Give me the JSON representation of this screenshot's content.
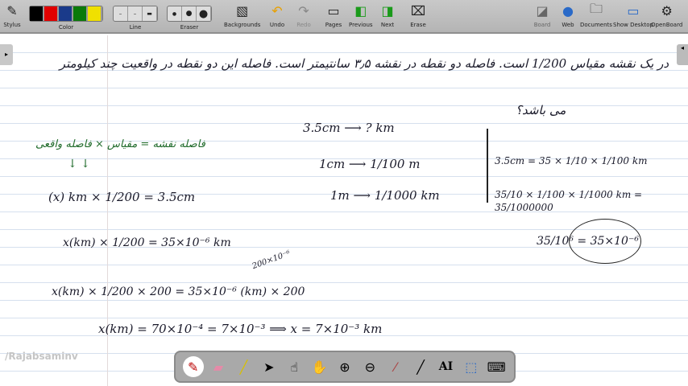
{
  "toolbar": {
    "stylus": "Stylus",
    "color": "Color",
    "line": "Line",
    "eraser": "Eraser",
    "backgrounds": "Backgrounds",
    "undo": "Undo",
    "redo": "Redo",
    "pages": "Pages",
    "previous": "Previous",
    "next": "Next",
    "erase": "Erase",
    "board": "Board",
    "web": "Web",
    "documents": "Documents",
    "show_desktop": "Show Desktop",
    "openboard": "OpenBoard",
    "colors": [
      "#000000",
      "#e00000",
      "#1a3a8a",
      "#0a7a0a",
      "#f0e000"
    ]
  },
  "board": {
    "question_line1": "در یک نقشه مقیاس 1/200 است. فاصله دو نقطه در نقشه ۳٫۵ سانتیمتر است. فاصله این دو نقطه در واقعیت چند کیلومتر",
    "question_line2": "می باشد؟",
    "formula": "فاصله نقشه = مقیاس × فاصله واقعی",
    "arrows": "↓        ↓",
    "eq1": "(x) km  ×  1/200  =  3.5cm",
    "eq2": "x(km) × 1/200 = 35×10⁻⁶ km",
    "note": "200×10⁻⁶",
    "eq3": "x(km) × 1/200 × 200 = 35×10⁻⁶ (km) × 200",
    "eq4": "x(km) = 70×10⁻⁴ = 7×10⁻³ ⟹ x = 7×10⁻³ km",
    "conv1": "3.5cm ⟶ ? km",
    "conv2": "1cm ⟶ 1/100 m",
    "conv3": "1m ⟶ 1/1000 km",
    "r1": "3.5cm = 35 × 1/10 × 1/100 km",
    "r2": "35/10 × 1/100 × 1/1000 km = 35/1000000",
    "r3": "35/10⁶ = 35×10⁻⁶",
    "watermark": "/Rajabsaminv"
  }
}
